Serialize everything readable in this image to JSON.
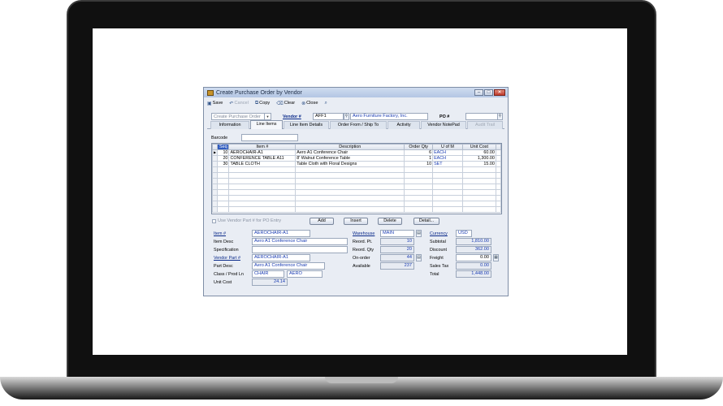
{
  "window": {
    "title": "Create Purchase Order by Vendor",
    "controls": {
      "minimize": "–",
      "maximize": "□",
      "close": "✕"
    }
  },
  "toolbar": {
    "save": "Save",
    "cancel": "Cancel",
    "copy": "Copy",
    "clear": "Clear",
    "close": "Close"
  },
  "header": {
    "mode": "Create Purchase Order",
    "vendor_label": "Vendor #",
    "vendor_code": "AFF1",
    "vendor_name": "Aero Furniture Factory, Inc.",
    "po_label": "PO #",
    "po_value": ""
  },
  "tabs": [
    "Information",
    "Line Items",
    "Line Item Details",
    "Order From / Ship To",
    "Activity",
    "Vendor NotePad",
    "Audit Trail"
  ],
  "barcode": {
    "label": "Barcode",
    "value": ""
  },
  "grid": {
    "columns": [
      "Seq",
      "Item #",
      "Description",
      "Order Qty",
      "U of M",
      "Unit Cost"
    ],
    "rows": [
      {
        "seq": "10",
        "item": "AEROCHAIR-A1",
        "desc": "Aero A1 Conference Chair",
        "qty": "6",
        "uom": "EACH",
        "cost": "60.00"
      },
      {
        "seq": "20",
        "item": "CONFERENCE TABLE A11",
        "desc": "8' Walnut Conference Table",
        "qty": "1",
        "uom": "EACH",
        "cost": "1,300.00"
      },
      {
        "seq": "30",
        "item": "TABLE CLOTH",
        "desc": "Table Cloth with Floral Designs",
        "qty": "10",
        "uom": "SET",
        "cost": "15.00"
      }
    ]
  },
  "actions": {
    "use_vendor_part": "Use Vendor Part # for PO Entry",
    "add": "Add",
    "insert": "Insert",
    "delete": "Delete",
    "detail": "Detail..."
  },
  "details": {
    "item_label": "Item #",
    "item": "AEROCHAIR-A1",
    "item_desc_label": "Item Desc",
    "item_desc": "Aero A1 Conference Chair",
    "spec_label": "Specification",
    "spec": "",
    "vendor_part_label": "Vendor Part #",
    "vendor_part": "AEROCHAIR-A1",
    "part_desc_label": "Part Desc",
    "part_desc": "Aero A1 Conference Chair",
    "class_label": "Class / Prod Ln",
    "class": "CHAIR",
    "prod_line": "AERO",
    "unit_cost_label": "Unit Cost",
    "unit_cost": "24.14"
  },
  "warehouse": {
    "warehouse_label": "Warehouse",
    "warehouse": "MAIN",
    "reord_pt_label": "Reord. Pt.",
    "reord_pt": "10",
    "reord_qty_label": "Reord. Qty",
    "reord_qty": "20",
    "on_order_label": "On-order",
    "on_order": "44",
    "available_label": "Available",
    "available": "237"
  },
  "totals": {
    "currency_label": "Currency",
    "currency": "USD",
    "subtotal_label": "Subtotal",
    "subtotal": "1,810.00",
    "discount_label": "Discount",
    "discount": "362.00",
    "freight_label": "Freight",
    "freight": "0.00",
    "sales_tax_label": "Sales Tax",
    "sales_tax": "0.00",
    "total_label": "Total",
    "total": "1,448.00"
  }
}
